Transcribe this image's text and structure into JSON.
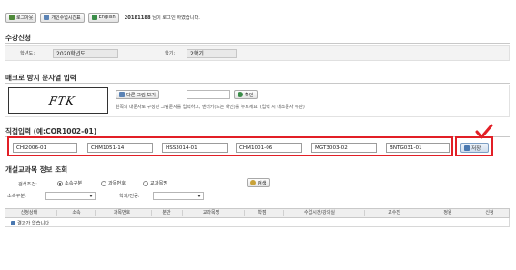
{
  "topbar": {
    "logout_label": "로그아웃",
    "privacy_label": "개인수업시간표",
    "english_label": "English",
    "welcome_id": "20181188",
    "welcome_suffix": " 님이 로그인 하였습니다."
  },
  "enroll": {
    "title": "수강신청",
    "year_label": "학년도:",
    "year_value": "2020학년도",
    "term_label": "학기:",
    "term_value": "2학기"
  },
  "captcha": {
    "title": "매크로 방지 문자열 입력",
    "image_text": "FTK",
    "other_label": "다른 그림 보기",
    "confirm_label": "확인",
    "input_value": "",
    "help": "왼쪽의 대문자로 구성된 그림문자를 입력하고, 엔터키(또는 확인)를 누르세요. (입력 시 대소문자 무관)"
  },
  "direct": {
    "title": "직접입력 (예:COR1002-01)",
    "codes": [
      "CHI2006-01",
      "CHM1051-14",
      "HSS3014-01",
      "CHM1001-06",
      "MGT3003-02",
      "BNTG031-01"
    ],
    "save_label": "저장"
  },
  "search": {
    "title": "개설교과목 정보 조회",
    "condition_label": "검색조건:",
    "radio": [
      "소속구분",
      "과목번호",
      "교과목명"
    ],
    "btn_label": "검색",
    "dept_label": "소속구분:",
    "major_label": "학과/전공:"
  },
  "table": {
    "headers": [
      "신청상태",
      "소속",
      "과목번호",
      "분반",
      "교과목명",
      "학점",
      "수업시간/강의실",
      "교수진",
      "정원",
      "신청"
    ],
    "empty": "결과가 없습니다"
  },
  "colors": {
    "accent_red": "#e21f26"
  }
}
